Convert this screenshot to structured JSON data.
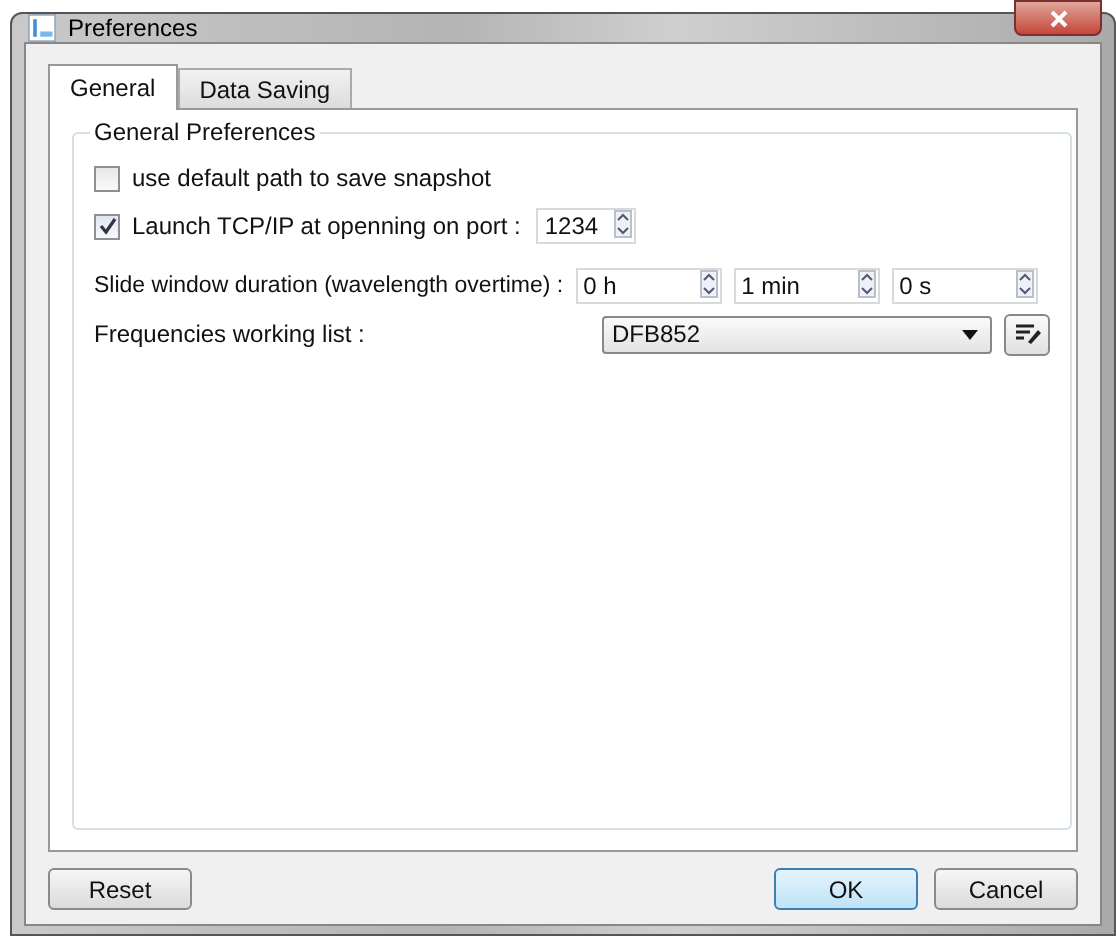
{
  "window": {
    "title": "Preferences"
  },
  "tabs": [
    {
      "label": "General",
      "selected": true
    },
    {
      "label": "Data Saving",
      "selected": false
    }
  ],
  "group": {
    "title": "General Preferences",
    "default_path": {
      "label": "use default path to save snapshot",
      "checked": false
    },
    "tcp": {
      "label": "Launch TCP/IP at openning on port :",
      "checked": true,
      "port": "1234"
    },
    "slide_window": {
      "label": "Slide window duration (wavelength overtime) :",
      "fields": [
        "0 h",
        "1 min",
        "0 s"
      ]
    },
    "frequencies": {
      "label": "Frequencies working list :",
      "value": "DFB852"
    }
  },
  "buttons": [
    {
      "label": "Reset",
      "kind": "normal"
    },
    {
      "label": "OK",
      "kind": "default"
    },
    {
      "label": "Cancel",
      "kind": "normal"
    }
  ]
}
